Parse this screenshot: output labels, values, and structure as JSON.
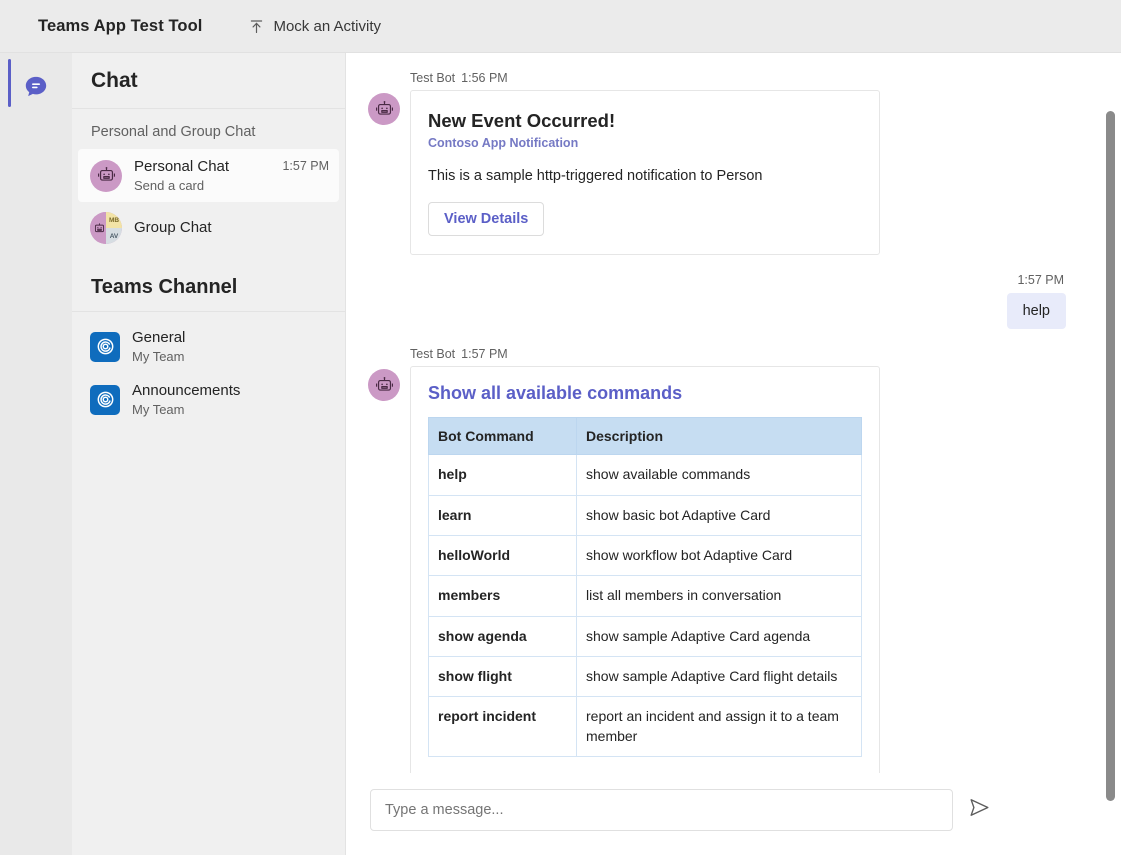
{
  "topbar": {
    "app_title": "Teams App Test Tool",
    "mock_activity_label": "Mock an Activity",
    "mock_activity_icon": "upload-icon"
  },
  "rail": {
    "items": [
      {
        "icon": "chat-bubble-icon",
        "active": true
      }
    ],
    "accent_color": "#5b5fc7"
  },
  "chatlist": {
    "header": "Chat",
    "personal_section_label": "Personal and Group Chat",
    "conversations": [
      {
        "name": "Personal Chat",
        "preview": "Send a card",
        "time": "1:57 PM",
        "avatar": "bot-avatar",
        "selected": true
      },
      {
        "name": "Group Chat",
        "preview": "",
        "time": "",
        "avatar": "group-avatar",
        "selected": false
      }
    ],
    "group_avatar_initials": [
      "MB",
      "AV"
    ],
    "teams_section_title": "Teams Channel",
    "channels": [
      {
        "name": "General",
        "team": "My Team",
        "icon": "teams-channel-icon"
      },
      {
        "name": "Announcements",
        "team": "My Team",
        "icon": "teams-channel-icon"
      }
    ]
  },
  "conversation": {
    "messages": [
      {
        "sender": "Test Bot",
        "time": "1:56 PM",
        "card": {
          "title": "New Event Occurred!",
          "subtitle": "Contoso App Notification",
          "text": "This is a sample http-triggered notification to Person",
          "button_label": "View Details"
        }
      }
    ],
    "outgoing": {
      "time": "1:57 PM",
      "text": "help"
    },
    "commands_message": {
      "sender": "Test Bot",
      "time": "1:57 PM",
      "card_title": "Show all available commands",
      "table": {
        "headers": [
          "Bot Command",
          "Description"
        ],
        "rows": [
          [
            "help",
            "show available commands"
          ],
          [
            "learn",
            "show basic bot Adaptive Card"
          ],
          [
            "helloWorld",
            "show workflow bot Adaptive Card"
          ],
          [
            "members",
            "list all members in conversation"
          ],
          [
            "show agenda",
            "show sample Adaptive Card agenda"
          ],
          [
            "show flight",
            "show sample Adaptive Card flight details"
          ],
          [
            "report incident",
            "report an incident and assign it to a team member"
          ]
        ]
      }
    }
  },
  "composer": {
    "placeholder": "Type a message...",
    "value": "",
    "send_icon": "send-paper-plane-icon"
  },
  "colors": {
    "accent": "#5b5fc7",
    "bot_avatar": "#cb99c5",
    "channel_icon": "#0f6cbd",
    "table_header": "#c6ddf2",
    "outgoing_bubble": "#e8ebfa"
  }
}
